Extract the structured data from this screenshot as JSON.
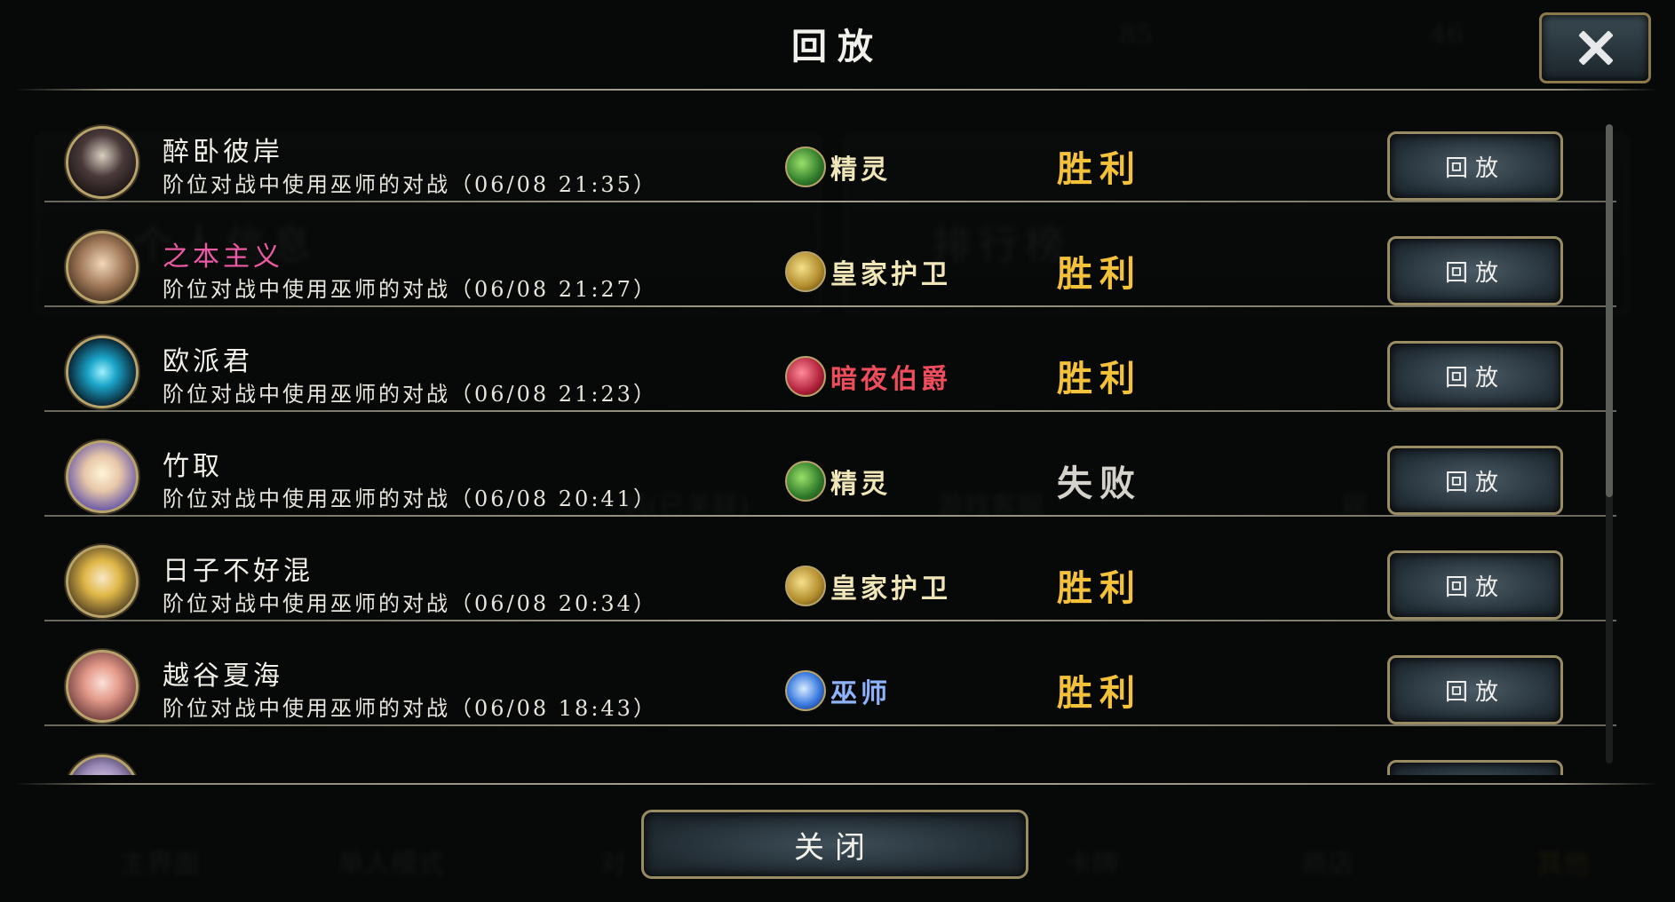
{
  "dialog": {
    "title": "回放",
    "close_button_label": "关闭"
  },
  "colors": {
    "win": "#f3c23a",
    "lose": "#d4d2ca",
    "forest": "#f0e6b8",
    "royal": "#f0e6b8",
    "night": "#ee4d5c",
    "rune": "#8fb4ff",
    "pink_name": "#ee5aa6"
  },
  "replays": [
    {
      "player": "醉卧彼岸",
      "description": "阶位对战中使用巫师的对战（06/08 21:35）",
      "opponent_class": "精灵",
      "class_icon": "leaf-icon",
      "result": "胜利",
      "replay_label": "回放"
    },
    {
      "player": "之本主义",
      "description": "阶位对战中使用巫师的对战（06/08 21:27）",
      "opponent_class": "皇家护卫",
      "class_icon": "crown-icon",
      "result": "胜利",
      "replay_label": "回放"
    },
    {
      "player": "欧派君",
      "description": "阶位对战中使用巫师的对战（06/08 21:23）",
      "opponent_class": "暗夜伯爵",
      "class_icon": "fang-icon",
      "result": "胜利",
      "replay_label": "回放"
    },
    {
      "player": "竹取",
      "description": "阶位对战中使用巫师的对战（06/08 20:41）",
      "opponent_class": "精灵",
      "class_icon": "leaf-icon",
      "result": "失败",
      "replay_label": "回放"
    },
    {
      "player": "日子不好混",
      "description": "阶位对战中使用巫师的对战（06/08 20:34）",
      "opponent_class": "皇家护卫",
      "class_icon": "crown-icon",
      "result": "胜利",
      "replay_label": "回放"
    },
    {
      "player": "越谷夏海",
      "description": "阶位对战中使用巫师的对战（06/08 18:43）",
      "opponent_class": "巫师",
      "class_icon": "rune-icon",
      "result": "胜利",
      "replay_label": "回放"
    }
  ],
  "background": {
    "panel_left": "个人信息",
    "panel_right": "排行榜",
    "nav": [
      "主界面",
      "单人模式",
      "对",
      "卡牌",
      "商店",
      "其他"
    ],
    "misc": [
      "机(已关联)",
      "游戏客服",
      "观"
    ],
    "gold": "85",
    "crystal": "46"
  }
}
